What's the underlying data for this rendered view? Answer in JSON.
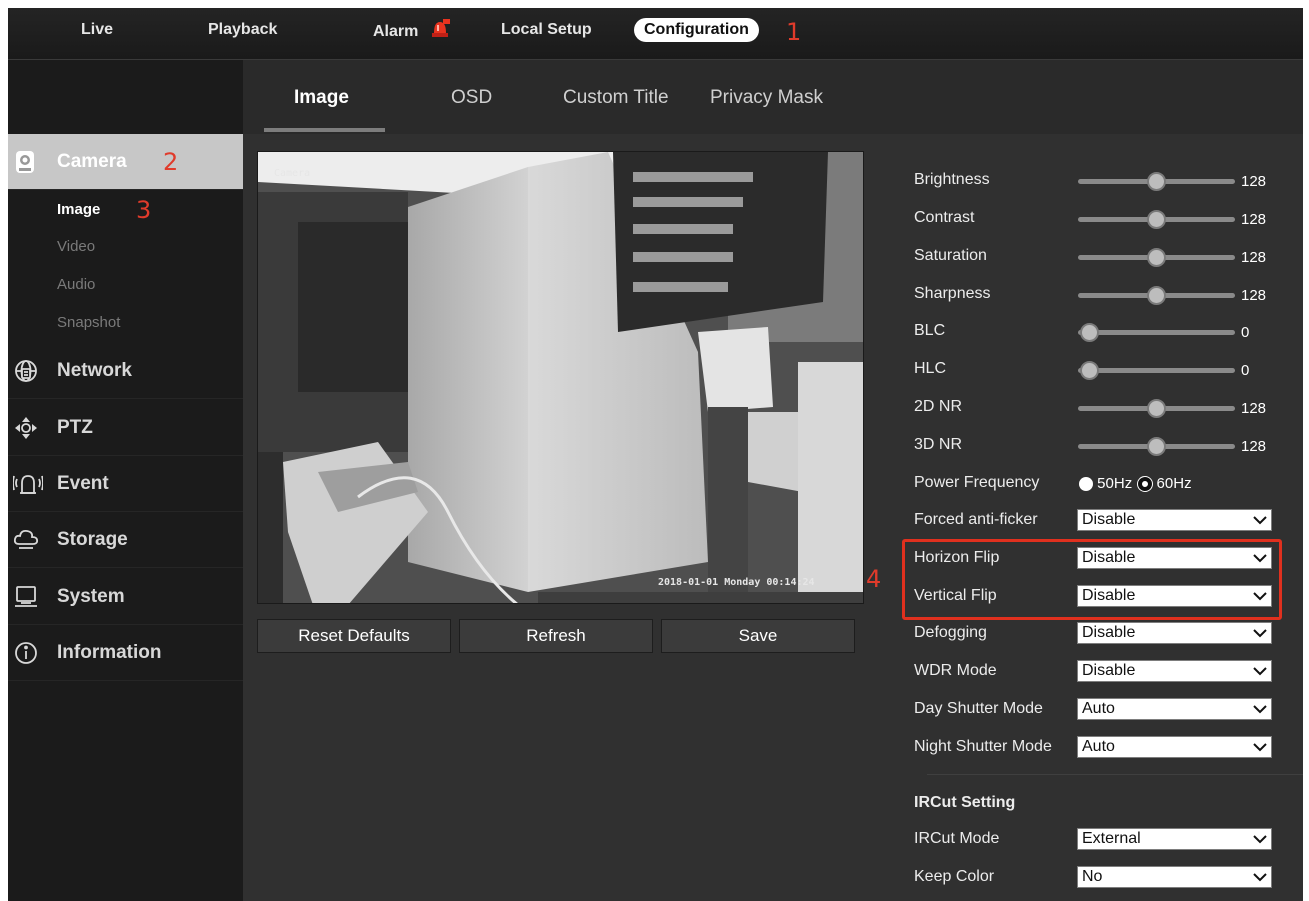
{
  "top_nav": {
    "items": [
      {
        "label": "Live"
      },
      {
        "label": "Playback"
      },
      {
        "label": "Alarm"
      },
      {
        "label": "Local Setup"
      },
      {
        "label": "Configuration"
      }
    ],
    "active": "Configuration"
  },
  "annotations": {
    "n1": "1",
    "n2": "2",
    "n3": "3",
    "n4": "4"
  },
  "sidebar": {
    "categories": [
      {
        "label": "Camera",
        "icon": "camera-icon"
      },
      {
        "label": "Network",
        "icon": "network-globe-icon"
      },
      {
        "label": "PTZ",
        "icon": "ptz-arrows-icon"
      },
      {
        "label": "Event",
        "icon": "event-alarm-icon"
      },
      {
        "label": "Storage",
        "icon": "storage-cloud-icon"
      },
      {
        "label": "System",
        "icon": "system-monitor-icon"
      },
      {
        "label": "Information",
        "icon": "info-icon"
      }
    ],
    "camera_sub": [
      {
        "label": "Image"
      },
      {
        "label": "Video"
      },
      {
        "label": "Audio"
      },
      {
        "label": "Snapshot"
      }
    ]
  },
  "tabs": [
    {
      "label": "Image"
    },
    {
      "label": "OSD"
    },
    {
      "label": "Custom Title"
    },
    {
      "label": "Privacy Mask"
    }
  ],
  "preview": {
    "camera_name": "Camera",
    "timestamp": "2018-01-01 Monday 00:14:24"
  },
  "buttons": {
    "reset": "Reset Defaults",
    "refresh": "Refresh",
    "save": "Save"
  },
  "sliders": [
    {
      "label": "Brightness",
      "value": "128",
      "level": 0.5
    },
    {
      "label": "Contrast",
      "value": "128",
      "level": 0.5
    },
    {
      "label": "Saturation",
      "value": "128",
      "level": 0.5
    },
    {
      "label": "Sharpness",
      "value": "128",
      "level": 0.5
    },
    {
      "label": "BLC",
      "value": "0",
      "level": 0
    },
    {
      "label": "HLC",
      "value": "0",
      "level": 0
    },
    {
      "label": "2D NR",
      "value": "128",
      "level": 0.5
    },
    {
      "label": "3D NR",
      "value": "128",
      "level": 0.5
    }
  ],
  "power_frequency": {
    "label": "Power Frequency",
    "options": [
      "50Hz",
      "60Hz"
    ],
    "selected": "60Hz"
  },
  "selects": [
    {
      "label": "Forced anti-ficker",
      "value": "Disable"
    },
    {
      "label": "Horizon Flip",
      "value": "Disable"
    },
    {
      "label": "Vertical Flip",
      "value": "Disable"
    },
    {
      "label": "Defogging",
      "value": "Disable"
    },
    {
      "label": "WDR Mode",
      "value": "Disable"
    },
    {
      "label": "Day Shutter Mode",
      "value": "Auto"
    },
    {
      "label": "Night Shutter Mode",
      "value": "Auto"
    }
  ],
  "ircut": {
    "heading": "IRCut Setting",
    "mode_label": "IRCut Mode",
    "mode_value": "External",
    "keep_color_label": "Keep Color",
    "keep_color_value": "No"
  },
  "colors": {
    "accent_red": "#e0301e",
    "panel": "#303030",
    "sidebar": "#1b1b1b"
  }
}
